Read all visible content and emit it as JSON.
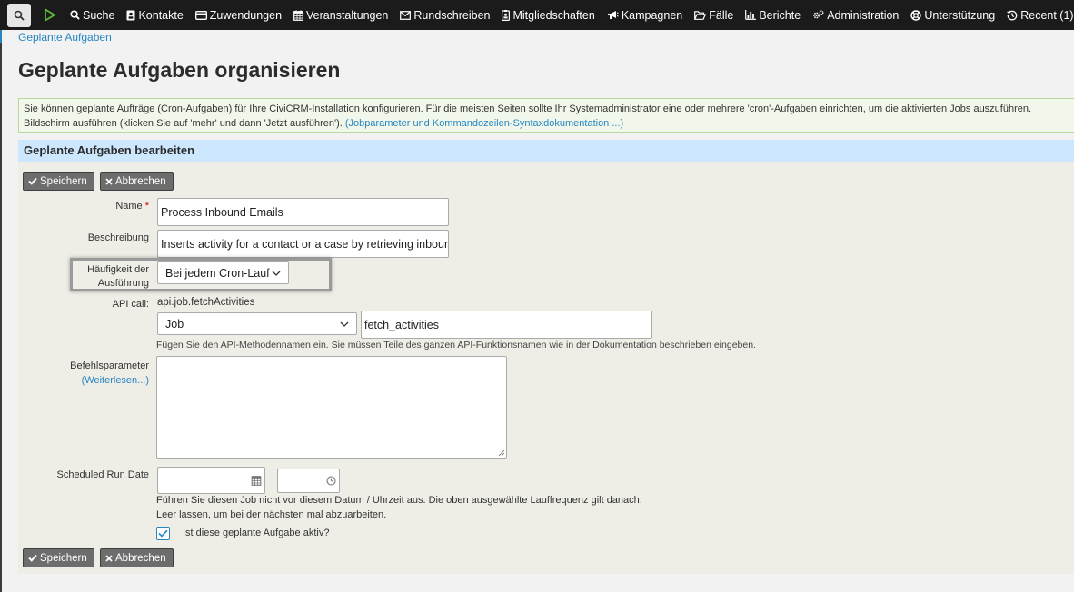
{
  "nav": {
    "items": [
      {
        "id": "suche",
        "label": "Suche",
        "icon": "search-icon"
      },
      {
        "id": "kontakte",
        "label": "Kontakte",
        "icon": "contact-card-icon"
      },
      {
        "id": "zuwendungen",
        "label": "Zuwendungen",
        "icon": "credit-card-icon"
      },
      {
        "id": "veranstaltungen",
        "label": "Veranstaltungen",
        "icon": "calendar-icon"
      },
      {
        "id": "rundschreiben",
        "label": "Rundschreiben",
        "icon": "envelope-icon"
      },
      {
        "id": "mitgliedschaften",
        "label": "Mitgliedschaften",
        "icon": "id-badge-icon"
      },
      {
        "id": "kampagnen",
        "label": "Kampagnen",
        "icon": "bullhorn-icon"
      },
      {
        "id": "faelle",
        "label": "Fälle",
        "icon": "folder-open-icon"
      },
      {
        "id": "berichte",
        "label": "Berichte",
        "icon": "bar-chart-icon"
      },
      {
        "id": "administration",
        "label": "Administration",
        "icon": "gears-icon"
      },
      {
        "id": "unterstuetzung",
        "label": "Unterstützung",
        "icon": "life-ring-icon"
      },
      {
        "id": "recent",
        "label": "Recent (1)",
        "icon": "history-icon"
      }
    ]
  },
  "breadcrumb": "Geplante Aufgaben",
  "page_title": "Geplante Aufgaben organisieren",
  "help": {
    "line1": "Sie können geplante Aufträge (Cron-Aufgaben) für Ihre CiviCRM-Installation konfigurieren. Für die meisten Seiten sollte Ihr Systemadministrator eine oder mehrere 'cron'-Aufgaben einrichten, um die aktivierten Jobs auszuführen.",
    "line2": "Bildschirm ausführen (klicken Sie auf 'mehr' und dann 'Jetzt ausführen').",
    "link": "(Jobparameter und Kommandozeilen-Syntaxdokumentation ...)"
  },
  "section_title": "Geplante Aufgaben bearbeiten",
  "buttons": {
    "save": "Speichern",
    "cancel": "Abbrechen"
  },
  "form": {
    "name_label": "Name",
    "required_mark": "*",
    "name_value": "Process Inbound Emails",
    "description_label": "Beschreibung",
    "description_value": "Inserts activity for a contact or a case by retrieving inbound emails.",
    "frequency_label_line1": "Häufigkeit der",
    "frequency_label_line2": "Ausführung",
    "frequency_value": "Bei jedem Cron-Lauf",
    "api_label": "API call:",
    "api_value": "api.job.fetchActivities",
    "entity_value": "Job",
    "action_value": "fetch_activities",
    "api_hint": "Fügen Sie den API-Methodennamen ein. Sie müssen Teile des ganzen API-Funktionsnamen wie in der Dokumentation beschrieben eingeben.",
    "params_label": "Befehlsparameter",
    "params_link": "(Weiterlesen...)",
    "params_value": "",
    "run_date_label": "Scheduled Run Date",
    "run_date_value": "",
    "run_time_value": "",
    "run_hint1": "Führen Sie diesen Job nicht vor diesem Datum / Uhrzeit aus. Die oben ausgewählte Lauffrequenz gilt danach.",
    "run_hint2": "Leer lassen, um bei der nächsten mal abzuarbeiten.",
    "active_label": "Ist diese geplante Aufgabe aktiv?",
    "active_checked": true
  },
  "colors": {
    "topbar": "#1b1b1b",
    "link": "#2786c2",
    "section_header": "#cde8fe",
    "help_bg": "#f1f8eb",
    "form_bg": "#eeede6",
    "button": "#6d6d6d"
  }
}
